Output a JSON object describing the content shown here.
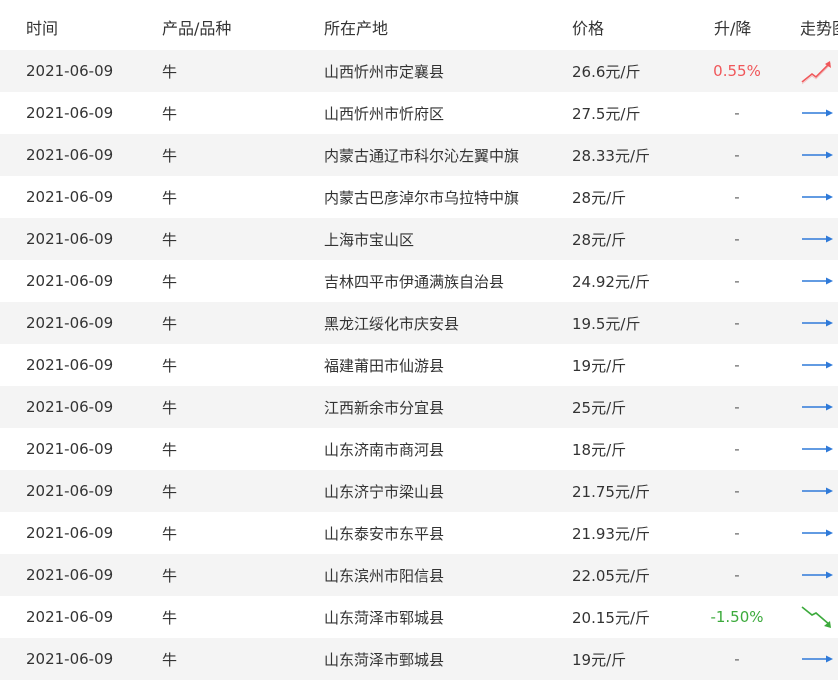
{
  "header": {
    "date": "时间",
    "product": "产品/品种",
    "origin": "所在产地",
    "price": "价格",
    "change": "升/降",
    "trend": "走势图"
  },
  "rows": [
    {
      "date": "2021-06-09",
      "product": "牛",
      "origin": "山西忻州市定襄县",
      "price": "26.6元/斤",
      "change": "0.55%",
      "trend": "up-icon"
    },
    {
      "date": "2021-06-09",
      "product": "牛",
      "origin": "山西忻州市忻府区",
      "price": "27.5元/斤",
      "change": "-",
      "trend": "flat-icon"
    },
    {
      "date": "2021-06-09",
      "product": "牛",
      "origin": "内蒙古通辽市科尔沁左翼中旗",
      "price": "28.33元/斤",
      "change": "-",
      "trend": "flat-icon"
    },
    {
      "date": "2021-06-09",
      "product": "牛",
      "origin": "内蒙古巴彦淖尔市乌拉特中旗",
      "price": "28元/斤",
      "change": "-",
      "trend": "flat-icon"
    },
    {
      "date": "2021-06-09",
      "product": "牛",
      "origin": "上海市宝山区",
      "price": "28元/斤",
      "change": "-",
      "trend": "flat-icon"
    },
    {
      "date": "2021-06-09",
      "product": "牛",
      "origin": "吉林四平市伊通满族自治县",
      "price": "24.92元/斤",
      "change": "-",
      "trend": "flat-icon"
    },
    {
      "date": "2021-06-09",
      "product": "牛",
      "origin": "黑龙江绥化市庆安县",
      "price": "19.5元/斤",
      "change": "-",
      "trend": "flat-icon"
    },
    {
      "date": "2021-06-09",
      "product": "牛",
      "origin": "福建莆田市仙游县",
      "price": "19元/斤",
      "change": "-",
      "trend": "flat-icon"
    },
    {
      "date": "2021-06-09",
      "product": "牛",
      "origin": "江西新余市分宜县",
      "price": "25元/斤",
      "change": "-",
      "trend": "flat-icon"
    },
    {
      "date": "2021-06-09",
      "product": "牛",
      "origin": "山东济南市商河县",
      "price": "18元/斤",
      "change": "-",
      "trend": "flat-icon"
    },
    {
      "date": "2021-06-09",
      "product": "牛",
      "origin": "山东济宁市梁山县",
      "price": "21.75元/斤",
      "change": "-",
      "trend": "flat-icon"
    },
    {
      "date": "2021-06-09",
      "product": "牛",
      "origin": "山东泰安市东平县",
      "price": "21.93元/斤",
      "change": "-",
      "trend": "flat-icon"
    },
    {
      "date": "2021-06-09",
      "product": "牛",
      "origin": "山东滨州市阳信县",
      "price": "22.05元/斤",
      "change": "-",
      "trend": "flat-icon"
    },
    {
      "date": "2021-06-09",
      "product": "牛",
      "origin": "山东菏泽市郓城县",
      "price": "20.15元/斤",
      "change": "-1.50%",
      "trend": "down-icon"
    },
    {
      "date": "2021-06-09",
      "product": "牛",
      "origin": "山东菏泽市鄄城县",
      "price": "19元/斤",
      "change": "-",
      "trend": "flat-icon"
    }
  ],
  "colors": {
    "up": "#f0575a",
    "down": "#3caa3c",
    "flat": "#2f7ad9",
    "stripe": "#f4f4f4"
  }
}
